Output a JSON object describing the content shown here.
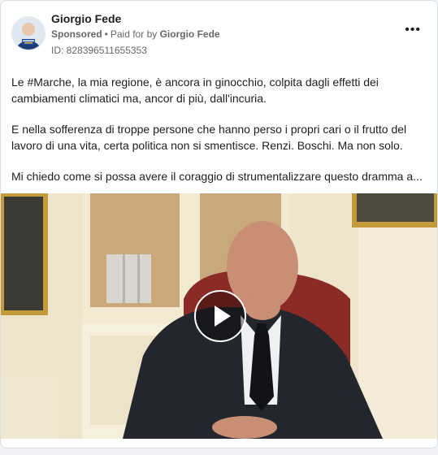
{
  "post": {
    "page_name": "Giorgio Fede",
    "sponsored_label": "Sponsored",
    "separator": "•",
    "paid_for_prefix": "Paid for by",
    "payer": "Giorgio Fede",
    "ad_id": "ID: 828396511655353",
    "more_icon": "more-options-icon",
    "paragraphs": [
      "Le #Marche, la mia regione, è ancora in ginocchio, colpita dagli effetti dei cambiamenti climatici ma, ancor di più, dall'incuria.",
      "E nella sofferenza di troppe persone che hanno perso i propri cari o il frutto del lavoro di una vita, certa politica non si smentisce. Renzi. Boschi. Ma non solo.",
      "Mi chiedo come si possa avere il coraggio di strumentalizzare questo dramma a..."
    ]
  },
  "video": {
    "play_icon": "play-icon"
  },
  "colors": {
    "text_primary": "#1c1e21",
    "text_secondary": "#65676b",
    "card_border": "#dadde1",
    "page_background": "#f0f2f5"
  }
}
